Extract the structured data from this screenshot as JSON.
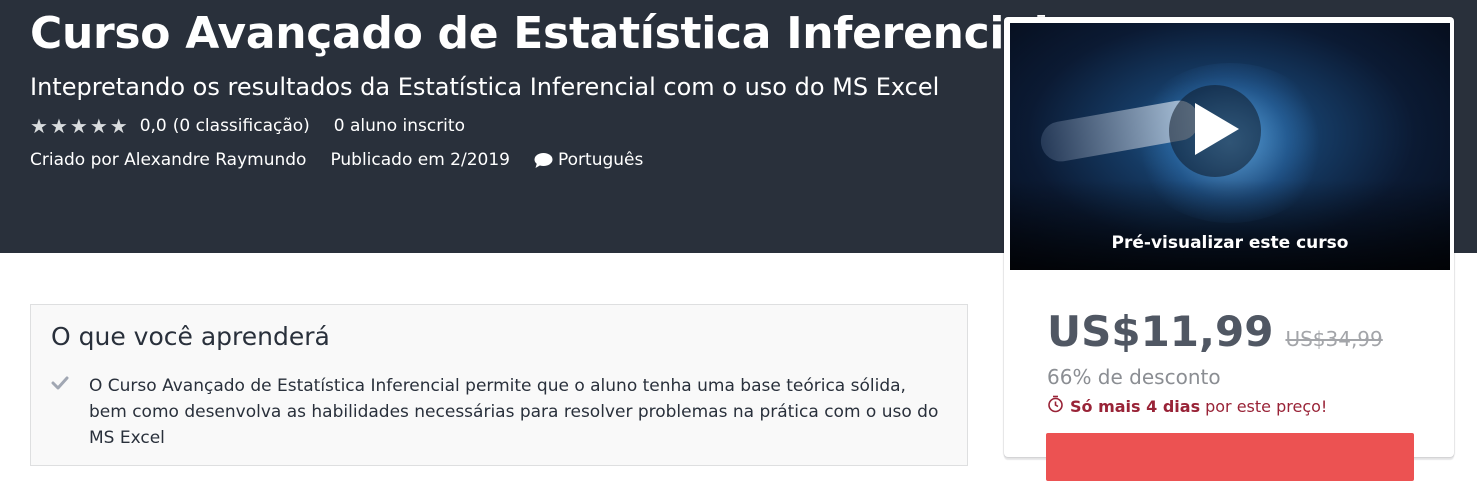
{
  "course": {
    "title": "Curso Avançado de Estatística Inferencial",
    "subtitle": "Intepretando os resultados da Estatística Inferencial com o uso do MS Excel",
    "rating_value": "0,0",
    "rating_count_text": "(0 classificação)",
    "rating_stars": 0,
    "students_text": "0 aluno inscrito",
    "created_by_text": "Criado por Alexandre Raymundo",
    "published_text": "Publicado em 2/2019",
    "language": "Português"
  },
  "learn": {
    "heading": "O que você aprenderá",
    "items": [
      "O Curso Avançado de Estatística Inferencial permite que o aluno tenha uma base teórica sólida, bem como desenvolva as habilidades necessárias para resolver problemas na prática com o uso do MS Excel"
    ]
  },
  "sidebar": {
    "preview_label": "Pré-visualizar este curso",
    "price": "US$11,99",
    "original_price": "US$34,99",
    "discount_text": "66% de desconto",
    "deadline_bold": "Só mais 4 dias",
    "deadline_rest": "por este preço!"
  },
  "icons": {
    "star": "star-icon",
    "chat": "chat-bubble-icon",
    "play": "play-icon",
    "check": "check-icon",
    "alarm": "alarm-clock-icon"
  },
  "colors": {
    "hero_bg": "#29303b",
    "accent_button": "#ec5252",
    "deadline": "#992337",
    "price": "#505763"
  }
}
